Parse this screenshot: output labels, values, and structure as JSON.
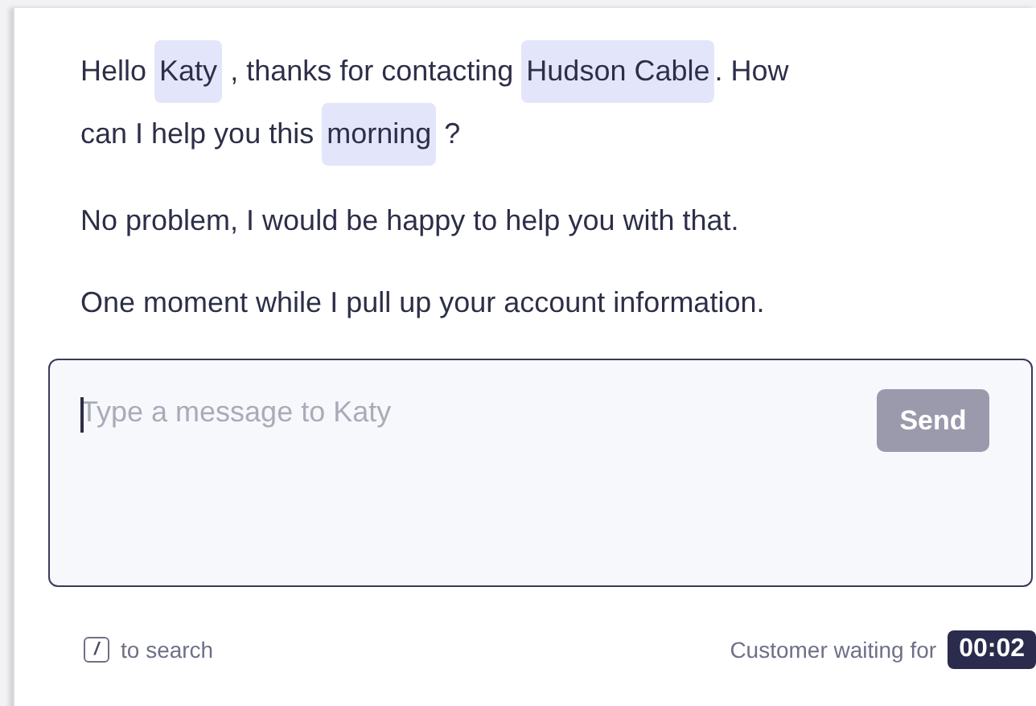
{
  "messages": [
    {
      "parts": [
        {
          "kind": "text",
          "text": "Hello "
        },
        {
          "kind": "variable",
          "text": "Katy"
        },
        {
          "kind": "text",
          "text": " , thanks for contacting "
        },
        {
          "kind": "variable",
          "text": "Hudson Cable"
        },
        {
          "kind": "text",
          "text": ". How "
        },
        {
          "kind": "text",
          "text": "can I help you this "
        },
        {
          "kind": "variable",
          "text": "morning"
        },
        {
          "kind": "text",
          "text": " ?"
        }
      ]
    },
    {
      "parts": [
        {
          "kind": "text",
          "text": "No problem, I would be happy to help you with that."
        }
      ]
    },
    {
      "parts": [
        {
          "kind": "text",
          "text": "One moment while I pull up your account information."
        }
      ]
    }
  ],
  "composer": {
    "placeholder": "Type a message to Katy",
    "send_button": "Send"
  },
  "footer": {
    "shortcut_key": "/",
    "shortcut_label": "to search",
    "waiting_label": "Customer waiting for",
    "waiting_time": "00:02"
  }
}
